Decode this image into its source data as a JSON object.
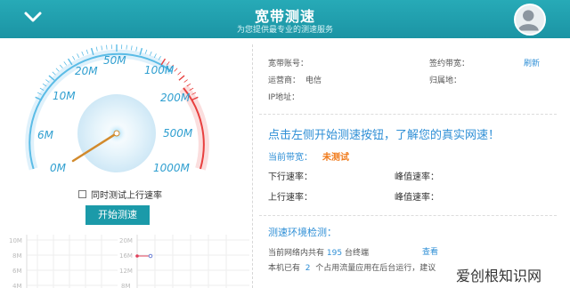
{
  "header": {
    "title": "宽带测速",
    "subtitle": "为您提供最专业的测速服务",
    "collapse_icon": "chevron-down-icon",
    "avatar_icon": "user-avatar-icon"
  },
  "gauge": {
    "tick_labels": [
      "0M",
      "6M",
      "10M",
      "20M",
      "50M",
      "100M",
      "200M",
      "500M",
      "1000M"
    ],
    "needle_value_label": "0M",
    "colors": {
      "arc": "#5bbce6",
      "high_arc": "#e8403f",
      "needle": "#d28a2c"
    }
  },
  "controls": {
    "checkbox_label": "同时测试上行速率",
    "checkbox_checked": false,
    "start_button": "开始测速"
  },
  "mini_charts": {
    "left": {
      "ticks": [
        "10M",
        "8M",
        "6M",
        "4M"
      ]
    },
    "right": {
      "ticks": [
        "20M",
        "16M",
        "12M",
        "8M"
      ]
    }
  },
  "account": {
    "account_label": "宽带账号：",
    "account_value": "",
    "contract_bw_label": "签约带宽：",
    "contract_bw_value": "",
    "refresh": "刷新",
    "isp_label": "运营商：",
    "isp_value": "电信",
    "location_label": "归属地：",
    "location_value": "",
    "ip_label": "IP地址：",
    "ip_value": ""
  },
  "test": {
    "prompt": "点击左侧开始测速按钮，了解您的真实网速！",
    "current_bw_label": "当前带宽：",
    "current_bw_value": "未测试",
    "down_label": "下行速率：",
    "down_peak_label": "峰值速率：",
    "up_label": "上行速率：",
    "up_peak_label": "峰值速率："
  },
  "env": {
    "title": "测速环境检测：",
    "line1_prefix": "当前网络内共有",
    "device_count": "195",
    "line1_suffix": "台终端",
    "view_link": "查看",
    "line2_prefix": "本机已有",
    "app_count": "2",
    "line2_suffix": "个占用流量应用在后台运行，建议"
  },
  "watermark": "爱创根知识网"
}
